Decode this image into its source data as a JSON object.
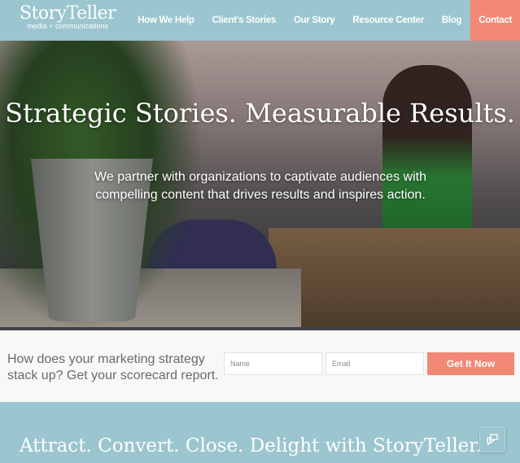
{
  "nav": {
    "logo_title": "StoryTeller",
    "logo_subtitle": "media + communications",
    "items": [
      {
        "label": "How We Help"
      },
      {
        "label": "Client's Stories"
      },
      {
        "label": "Our Story"
      },
      {
        "label": "Resource Center"
      },
      {
        "label": "Blog"
      },
      {
        "label": "Contact"
      }
    ]
  },
  "hero": {
    "title": "Strategic Stories. Measurable Results.",
    "subtitle": "We partner with organizations to captivate audiences with compelling content that drives results and inspires action."
  },
  "cta": {
    "question": "How does your marketing strategy stack up? Get your scorecard report.",
    "name_placeholder": "Name",
    "email_placeholder": "Email",
    "button": "Get It Now"
  },
  "section": {
    "heading": "Attract. Convert. Close. Delight with StoryTeller."
  },
  "colors": {
    "nav_bg": "#9bc5cf",
    "accent": "#f08875"
  },
  "icons": {
    "chat": "chat-bubbles-icon"
  }
}
